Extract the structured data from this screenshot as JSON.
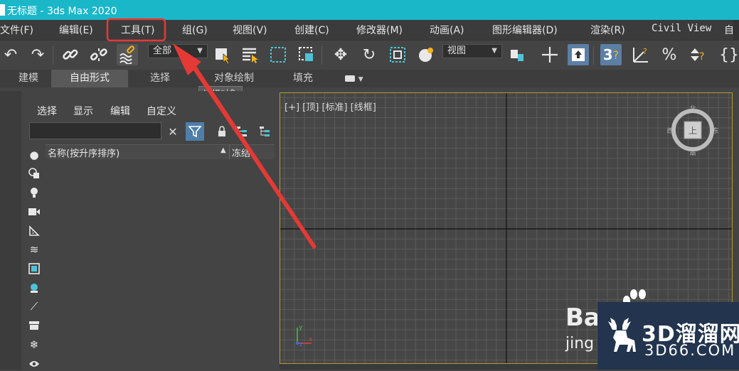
{
  "window": {
    "title": "无标题 - 3ds Max 2020"
  },
  "menubar": {
    "items": [
      {
        "label": "文件(F)"
      },
      {
        "label": "编辑(E)"
      },
      {
        "label": "工具(T)"
      },
      {
        "label": "组(G)"
      },
      {
        "label": "视图(V)"
      },
      {
        "label": "创建(C)"
      },
      {
        "label": "修改器(M)"
      },
      {
        "label": "动画(A)"
      },
      {
        "label": "图形编辑器(D)"
      },
      {
        "label": "渲染(R)"
      },
      {
        "label": "Civil View"
      }
    ],
    "highlighted": "工具(T)",
    "highlight_color": "#e53935"
  },
  "toolbar": {
    "selection_filter": "全部",
    "view_coord": "视图",
    "icons": [
      "undo-icon",
      "redo-icon",
      "link-icon",
      "unlink-icon",
      "bind-space-warp-icon",
      "select-object-icon",
      "select-by-name-icon",
      "rectangular-region-icon",
      "window-crossing-icon",
      "move-icon",
      "rotate-icon",
      "scale-icon",
      "pivot-icon",
      "snap-toggle-icon",
      "angle-snap-icon",
      "percent-snap-icon",
      "spinner-snap-icon",
      "named-selection-icon"
    ]
  },
  "ribbon": {
    "tabs": [
      {
        "label": "建模"
      },
      {
        "label": "自由形式"
      },
      {
        "label": "选择"
      },
      {
        "label": "对象绘制"
      },
      {
        "label": "填充"
      }
    ],
    "active": "自由形式",
    "tooltip": "选择对象"
  },
  "explorer": {
    "menu": [
      "选择",
      "显示",
      "编辑",
      "自定义"
    ],
    "search_value": "",
    "columns": {
      "name": "名称(按升序排序)",
      "frozen": "冻结"
    }
  },
  "viewport": {
    "label": "[+] [顶] [标准] [线框]",
    "border_color": "#b39a2e",
    "viewcube": {
      "n": "北",
      "s": "南",
      "e": "东",
      "w": "西",
      "face": "上"
    },
    "axis": {
      "y": "y",
      "x": "x",
      "z": "z"
    }
  },
  "watermarks": {
    "baidu_top": "Bai",
    "baidu_bottom": "jing",
    "site_name": "3D溜溜网",
    "site_url": "3D66.COM"
  },
  "annotation": {
    "arrow_color": "#e53935"
  }
}
